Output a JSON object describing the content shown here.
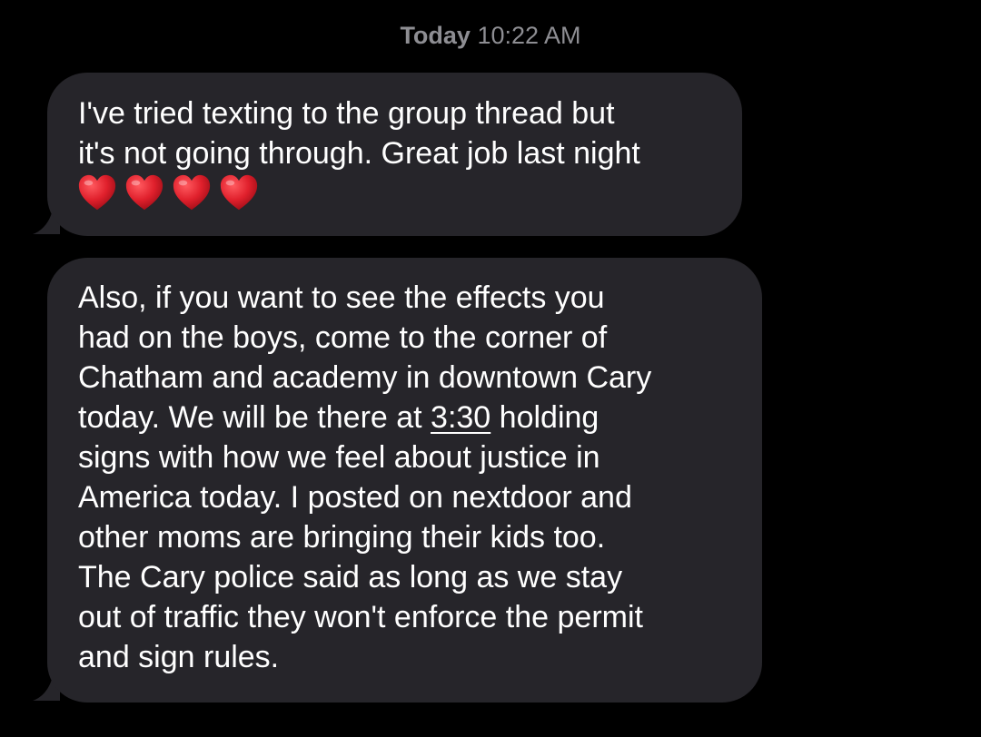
{
  "header": {
    "day": "Today",
    "time": "10:22 AM"
  },
  "messages": [
    {
      "lines": [
        "I've tried texting to the group thread but",
        "it's not going through. Great job last night"
      ],
      "emoji": "❤️❤️❤️❤️"
    },
    {
      "lines": [
        "Also, if you want to see the effects you",
        "had on the boys, come to the corner of",
        "Chatham and academy in downtown Cary",
        "today. We will be there at ",
        "signs with how we feel about justice in",
        "America today.  I posted on nextdoor and",
        "other moms are bringing their kids too.",
        "The Cary police said as long as we stay",
        "out of traffic they won't enforce the permit",
        "and sign rules."
      ],
      "link_time": "3:30",
      "line4_after": " holding"
    }
  ],
  "colors": {
    "background": "#000000",
    "bubble": "#26252a",
    "timestamp": "#8e8e93",
    "text": "#ffffff",
    "heart": "#e0202c"
  },
  "icons": {
    "heart": "red-heart-emoji"
  }
}
